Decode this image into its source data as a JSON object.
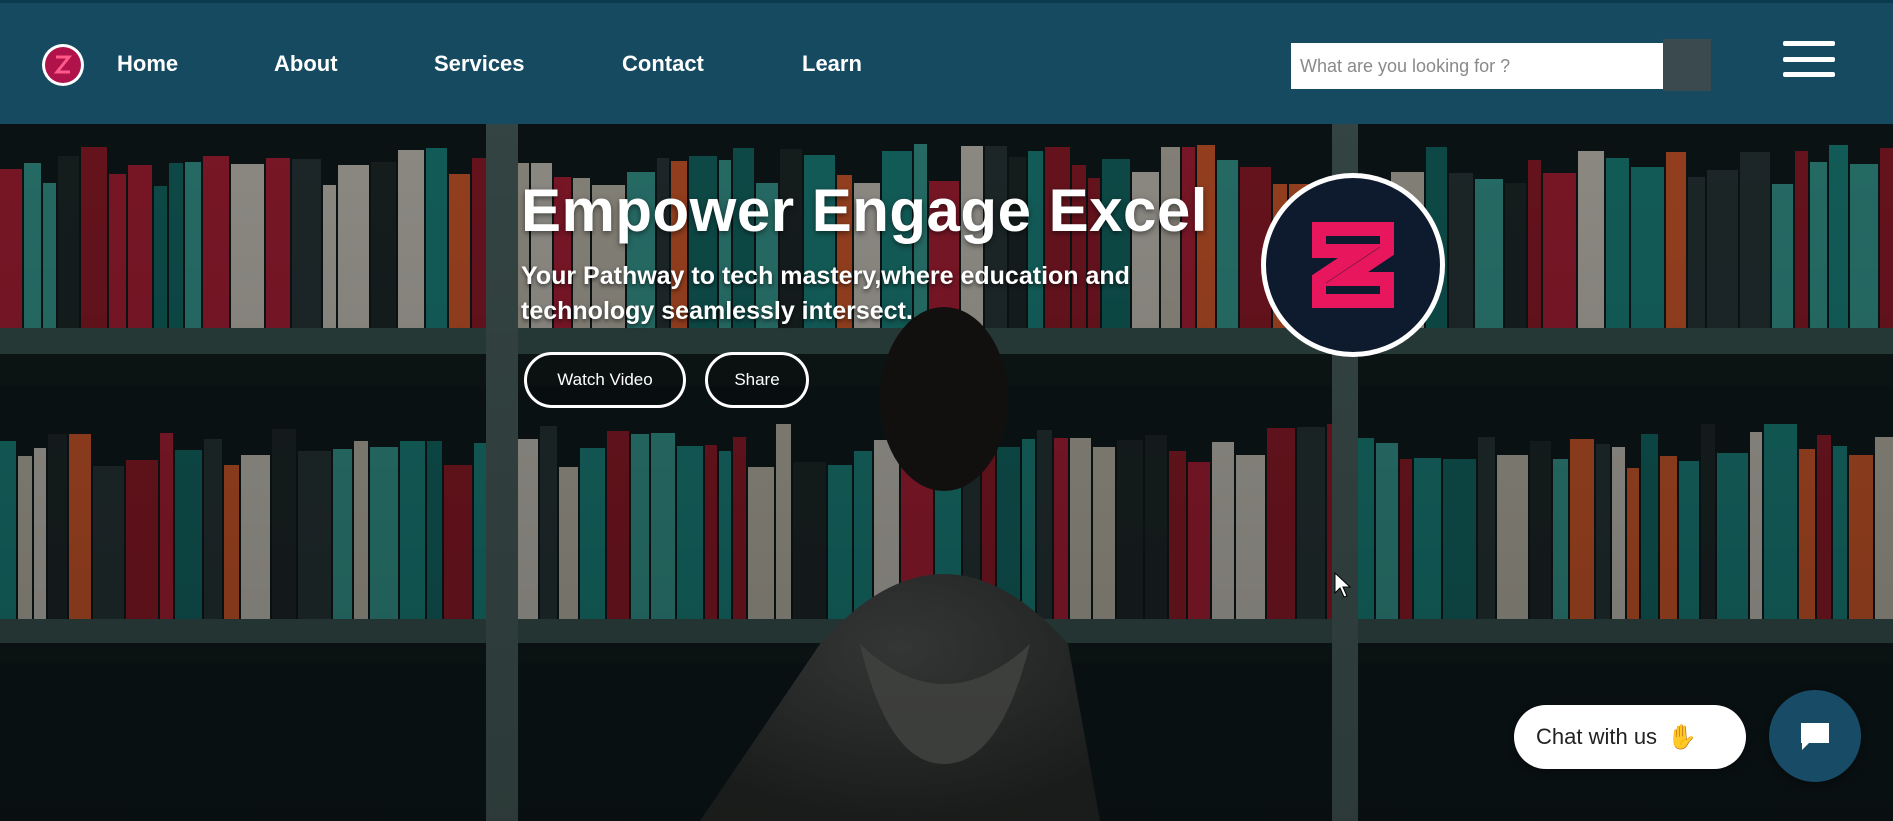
{
  "nav": {
    "logo_icon": "brand-logo-icon",
    "links": [
      {
        "label": "Home"
      },
      {
        "label": "About"
      },
      {
        "label": "Services"
      },
      {
        "label": "Contact"
      },
      {
        "label": "Learn"
      }
    ],
    "search": {
      "placeholder": "What are you looking for ?",
      "value": ""
    },
    "menu_icon": "hamburger-menu-icon"
  },
  "hero": {
    "title": "Empower Engage Excel",
    "subtitle": "Your Pathway to tech mastery,where education and technology seamlessly intersect.",
    "buttons": [
      {
        "label": "Watch Video"
      },
      {
        "label": "Share"
      }
    ],
    "badge_icon": "z-logo-icon",
    "background": "library-bookshelf-photo"
  },
  "chat": {
    "label": "Chat with us",
    "emoji_icon": "waving-hand-icon",
    "fab_icon": "chat-bubble-icon"
  },
  "colors": {
    "nav_bg": "#154a60",
    "accent_pink": "#e8175d",
    "badge_bg": "#0e1a2e",
    "chat_fab": "#174b66"
  }
}
